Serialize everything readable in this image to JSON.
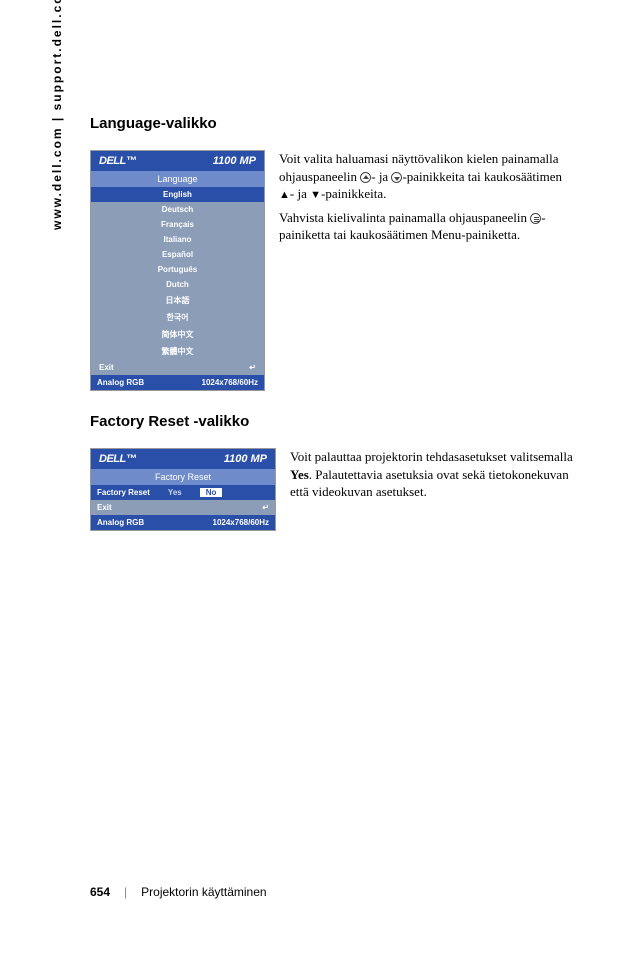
{
  "sidebar": "www.dell.com | support.dell.com",
  "sections": {
    "lang": {
      "heading": "Language-valikko",
      "menu": {
        "logo": "DELL™",
        "model": "1100 MP",
        "title": "Language",
        "items": [
          "English",
          "Deutsch",
          "Français",
          "Italiano",
          "Español",
          "Português",
          "Dutch",
          "日本語",
          "한국어",
          "简体中文",
          "繁體中文"
        ],
        "selected": "English",
        "exit": "Exit",
        "footer_left": "Analog RGB",
        "footer_right": "1024x768/60Hz"
      },
      "para1a": "Voit valita haluamasi näyttövalikon kielen painamalla ohjauspaneelin ",
      "para1b": "- ja ",
      "para1c": "-painikkeita tai kaukosäätimen ",
      "para1d": "- ja ",
      "para1e": "-painikkeita.",
      "para2a": "Vahvista kielivalinta painamalla ohjauspaneelin ",
      "para2b": "-painiketta tai kaukosäätimen Menu-painiketta."
    },
    "reset": {
      "heading": "Factory Reset -valikko",
      "menu": {
        "logo": "DELL™",
        "model": "1100 MP",
        "title": "Factory Reset",
        "row_label": "Factory Reset",
        "yes": "Yes",
        "no": "No",
        "exit": "Exit",
        "footer_left": "Analog RGB",
        "footer_right": "1024x768/60Hz"
      },
      "para_a": "Voit palauttaa projektorin tehdasasetukset valitsemalla ",
      "para_bold": "Yes",
      "para_b": ". Palautettavia asetuksia ovat sekä tietokonekuvan että videokuvan asetukset."
    }
  },
  "footer": {
    "page": "654",
    "chapter": "Projektorin käyttäminen"
  }
}
